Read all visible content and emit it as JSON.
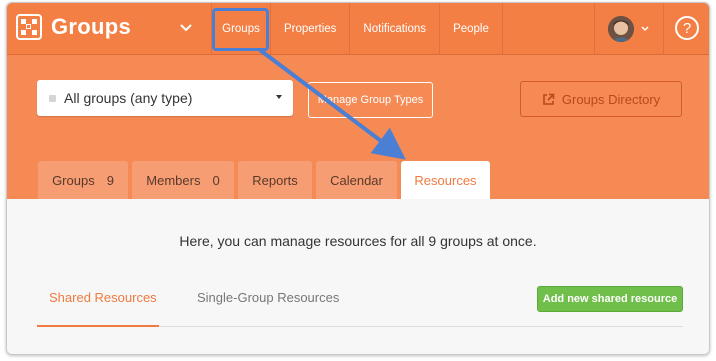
{
  "app": {
    "name": "Groups"
  },
  "nav": [
    {
      "label": "Groups",
      "selected": true
    },
    {
      "label": "Properties"
    },
    {
      "label": "Notifications"
    },
    {
      "label": "People"
    }
  ],
  "help_icon": "?",
  "header": {
    "group_select": {
      "value": "All groups (any type)"
    },
    "manage_button": "Manage Group Types",
    "directory_button": "Groups Directory"
  },
  "tabs": [
    {
      "label": "Groups",
      "count": "9"
    },
    {
      "label": "Members",
      "count": "0"
    },
    {
      "label": "Reports"
    },
    {
      "label": "Calendar"
    },
    {
      "label": "Resources",
      "active": true
    }
  ],
  "content": {
    "intro": "Here, you can manage resources for all 9 groups at once.",
    "subtabs": [
      "Shared Resources",
      "Single-Group Resources"
    ],
    "add_button": "Add new shared resource"
  },
  "colors": {
    "brand_orange": "#f47f45",
    "header_orange": "#f58a55",
    "highlight_blue": "#4a7fd4",
    "add_green": "#6fbf4a"
  }
}
